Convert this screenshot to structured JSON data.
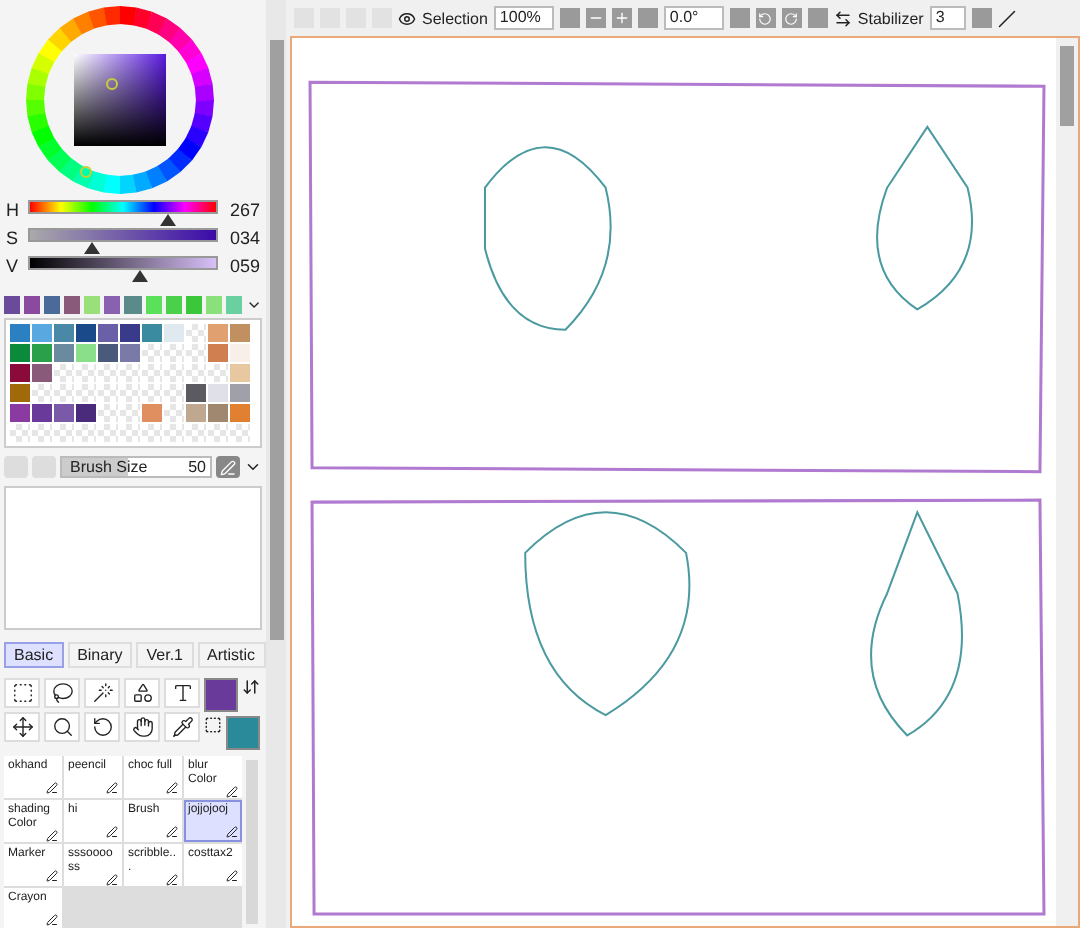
{
  "color": {
    "sliders": [
      {
        "label": "H",
        "level": 0.74,
        "reading": "267"
      },
      {
        "label": "S",
        "level": 0.34,
        "reading": "034"
      },
      {
        "label": "V",
        "level": 0.59,
        "reading": "059"
      }
    ]
  },
  "swatch_bar": [
    {
      "color": "#6a4a9a"
    },
    {
      "color": "#8a4aa0"
    },
    {
      "color": "#4a6a9a"
    },
    {
      "color": "#8a5a7a"
    },
    {
      "color": "#9ae07a"
    },
    {
      "color": "#8a60b0"
    },
    {
      "color": "#5a8a8a"
    },
    {
      "color": "#5ae05a"
    },
    {
      "color": "#4ad04a"
    },
    {
      "color": "#3ac83a"
    },
    {
      "color": "#8ae07a"
    },
    {
      "color": "#6ad0a0"
    }
  ],
  "swatch_grid": [
    [
      {
        "kind": "color",
        "color": "#2a80c0"
      },
      {
        "kind": "color",
        "color": "#5aa8e0"
      },
      {
        "kind": "color",
        "color": "#4a88a8"
      },
      {
        "kind": "color",
        "color": "#1a4a8a"
      },
      {
        "kind": "color",
        "color": "#6a60a8"
      },
      {
        "kind": "color",
        "color": "#3a3a8a"
      },
      {
        "kind": "color",
        "color": "#3a8aa0"
      },
      {
        "kind": "color",
        "color": "#e0e8f0"
      },
      {
        "kind": "empty"
      },
      {
        "kind": "color",
        "color": "#e0a070"
      },
      {
        "kind": "color",
        "color": "#c09060"
      }
    ],
    [
      {
        "kind": "color",
        "color": "#0a8a3a"
      },
      {
        "kind": "color",
        "color": "#2aa04a"
      },
      {
        "kind": "color",
        "color": "#6a8aa0"
      },
      {
        "kind": "color",
        "color": "#8ae08a"
      },
      {
        "kind": "color",
        "color": "#4a5a7a"
      },
      {
        "kind": "color",
        "color": "#7a7aa8"
      },
      {
        "kind": "empty"
      },
      {
        "kind": "empty"
      },
      {
        "kind": "empty"
      },
      {
        "kind": "color",
        "color": "#d08050"
      },
      {
        "kind": "color",
        "color": "#f8f0e8"
      }
    ],
    [
      {
        "kind": "color",
        "color": "#8a0a3a"
      },
      {
        "kind": "color",
        "color": "#8a5a7a"
      },
      {
        "kind": "empty"
      },
      {
        "kind": "empty"
      },
      {
        "kind": "empty"
      },
      {
        "kind": "empty"
      },
      {
        "kind": "empty"
      },
      {
        "kind": "empty"
      },
      {
        "kind": "empty"
      },
      {
        "kind": "empty"
      },
      {
        "kind": "color",
        "color": "#e8c8a0"
      }
    ],
    [
      {
        "kind": "color",
        "color": "#a06a0a"
      },
      {
        "kind": "empty"
      },
      {
        "kind": "empty"
      },
      {
        "kind": "empty"
      },
      {
        "kind": "empty"
      },
      {
        "kind": "empty"
      },
      {
        "kind": "empty"
      },
      {
        "kind": "empty"
      },
      {
        "kind": "color",
        "color": "#5a5a60"
      },
      {
        "kind": "color",
        "color": "#e0e0e8"
      },
      {
        "kind": "color",
        "color": "#a0a0a8"
      }
    ],
    [
      {
        "kind": "color",
        "color": "#8a3aa0"
      },
      {
        "kind": "color",
        "color": "#6a3a9a"
      },
      {
        "kind": "color",
        "color": "#7a5aa8"
      },
      {
        "kind": "color",
        "color": "#4a2a7a"
      },
      {
        "kind": "empty"
      },
      {
        "kind": "empty"
      },
      {
        "kind": "color",
        "color": "#e09060"
      },
      {
        "kind": "empty"
      },
      {
        "kind": "color",
        "color": "#c0a890"
      },
      {
        "kind": "color",
        "color": "#a08870"
      },
      {
        "kind": "color",
        "color": "#e08030"
      }
    ],
    [
      {
        "kind": "empty"
      },
      {
        "kind": "empty"
      },
      {
        "kind": "empty"
      },
      {
        "kind": "empty"
      },
      {
        "kind": "empty"
      },
      {
        "kind": "empty"
      },
      {
        "kind": "empty"
      },
      {
        "kind": "empty"
      },
      {
        "kind": "empty"
      },
      {
        "kind": "empty"
      },
      {
        "kind": "empty"
      }
    ]
  ],
  "brush_size": {
    "label": "Brush Size",
    "value": "50",
    "level": 0.45
  },
  "tool_tabs": [
    {
      "label": "Basic",
      "selected": true
    },
    {
      "label": "Binary",
      "selected": false
    },
    {
      "label": "Ver.1",
      "selected": false
    },
    {
      "label": "Artistic",
      "selected": false
    }
  ],
  "tools": [
    {
      "name": "okhand",
      "selected": false
    },
    {
      "name": "peencil",
      "selected": false
    },
    {
      "name": "choc full",
      "selected": false
    },
    {
      "name": "blur Color",
      "selected": false
    },
    {
      "name": "shading Color",
      "selected": false
    },
    {
      "name": "hi",
      "selected": false
    },
    {
      "name": "Brush",
      "selected": false
    },
    {
      "name": "jojjojooj",
      "selected": true
    },
    {
      "name": "Marker",
      "selected": false
    },
    {
      "name": "sssooooss",
      "selected": false
    },
    {
      "name": "scribble...",
      "selected": false
    },
    {
      "name": "costtax2",
      "selected": false
    },
    {
      "name": "Crayon",
      "selected": false
    }
  ],
  "toolbar": {
    "selection_label": "Selection",
    "zoom": "100%",
    "angle": "0.0°",
    "stabilizer_label": "Stabilizer",
    "stabilizer": "3"
  }
}
